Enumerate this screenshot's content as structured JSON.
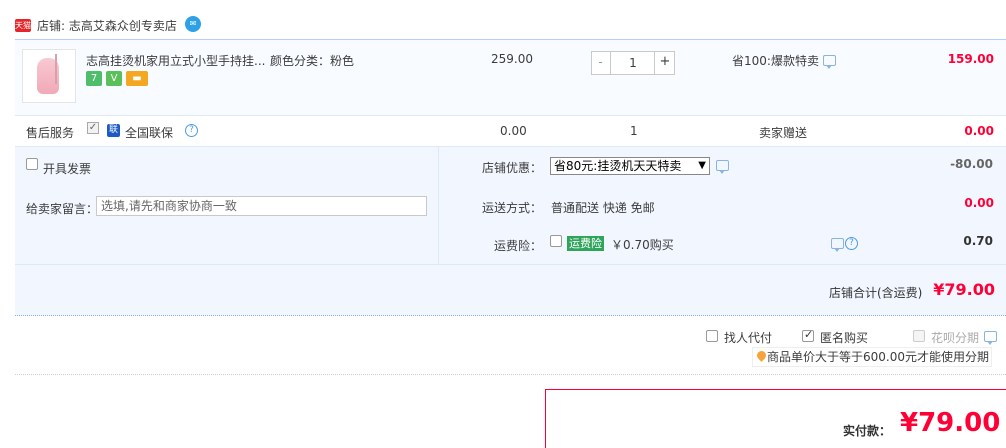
{
  "shop": {
    "badge": "天猫",
    "label": "店铺: 志高艾森众创专卖店",
    "ww_icon": "wangwang-chat-icon"
  },
  "item": {
    "title": "志高挂烫机家用立式小型手持挂...",
    "sku": "颜色分类：粉色",
    "badges": [
      "7",
      "V",
      "▬"
    ],
    "price": "259.00",
    "qty_minus": "-",
    "qty_value": "1",
    "qty_plus": "+",
    "promo": "省100:爆款特卖",
    "total": "159.00"
  },
  "service": {
    "label": "售后服务",
    "bao_icon": "联",
    "name": "全国联保",
    "price": "0.00",
    "qty": "1",
    "gift": "卖家赠送",
    "total": "0.00"
  },
  "options": {
    "invoice_label": "开具发票",
    "message_label": "给卖家留言：",
    "message_placeholder": "选填,请先和商家协商一致",
    "coupon_label": "店铺优惠：",
    "coupon_value": "省80元:挂烫机天天特卖",
    "coupon_total": "-80.00",
    "shipping_label": "运送方式：",
    "shipping_value": "普通配送 快递 免邮",
    "shipping_total": "0.00",
    "insurance_label": "运费险：",
    "insurance_tag": "运费险",
    "insurance_price": "￥0.70购买",
    "insurance_total": "0.70"
  },
  "shop_total": {
    "label": "店铺合计(含运费)",
    "value": "¥79.00"
  },
  "order_options": {
    "proxy_pay": "找人代付",
    "anonymous": "匿名购买",
    "installment": "花呗分期",
    "installment_note": "商品单价大于等于600.00元才能使用分期"
  },
  "pay": {
    "label": "实付款：",
    "value": "¥79.00"
  },
  "colors": {
    "accent_red": "#ff0036",
    "panel_blue": "#f2f7ff",
    "border_blue": "#b2d1ff"
  }
}
